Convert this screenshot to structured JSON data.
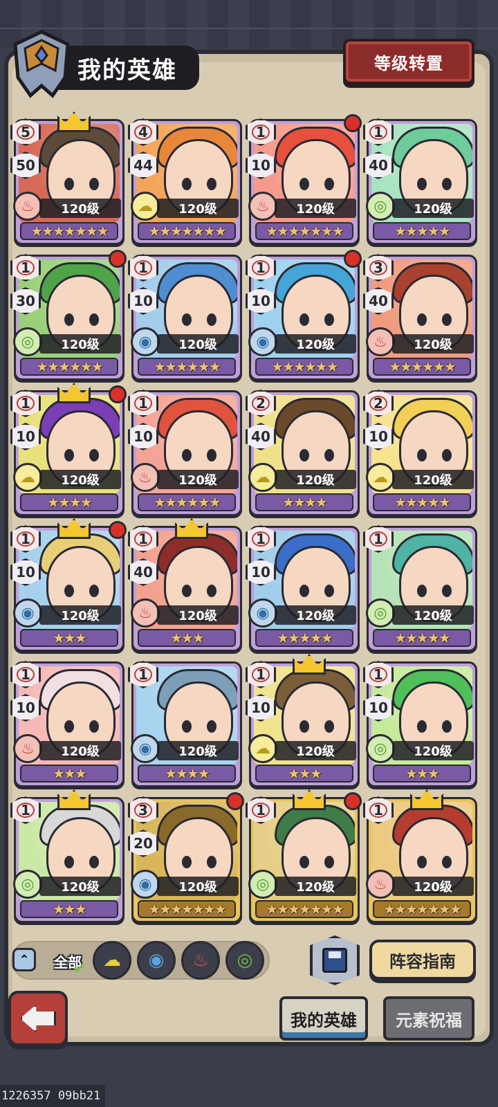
{
  "header": {
    "title": "我的英雄",
    "rank_transfer_button": "等级转置"
  },
  "colors": {
    "fire": "#c83d33",
    "water": "#2f6ea5",
    "earth": "#b89b18",
    "wind": "#4e9c2b",
    "card_purple": "#bda0d8",
    "card_gold": "#e7c45d",
    "button_red": "#8c2c2a"
  },
  "heroes": [
    {
      "rank": "5",
      "num": "50",
      "element": "fire",
      "level": "120级",
      "stars": 7,
      "crown": true,
      "dot": false,
      "art": "#d66a56",
      "hair": "#5d4a3a",
      "gold": false
    },
    {
      "rank": "4",
      "num": "44",
      "element": "earth",
      "level": "120级",
      "stars": 7,
      "crown": false,
      "dot": false,
      "art": "#f4a55a",
      "hair": "#e8873a",
      "gold": false
    },
    {
      "rank": "1",
      "num": "10",
      "element": "fire",
      "level": "120级",
      "stars": 7,
      "crown": false,
      "dot": true,
      "art": "#f59a8c",
      "hair": "#e7503d",
      "gold": false
    },
    {
      "rank": "1",
      "num": "40",
      "element": "wind",
      "level": "120级",
      "stars": 5,
      "crown": false,
      "dot": false,
      "art": "#a9e4c2",
      "hair": "#6ecb9a",
      "gold": false
    },
    {
      "rank": "1",
      "num": "30",
      "element": "wind",
      "level": "120级",
      "stars": 6,
      "crown": false,
      "dot": true,
      "art": "#9bd07a",
      "hair": "#4fa44a",
      "gold": false
    },
    {
      "rank": "1",
      "num": "10",
      "element": "water",
      "level": "120级",
      "stars": 6,
      "crown": false,
      "dot": false,
      "art": "#a3cdea",
      "hair": "#4f8fd1",
      "gold": false
    },
    {
      "rank": "1",
      "num": "10",
      "element": "water",
      "level": "120级",
      "stars": 6,
      "crown": false,
      "dot": true,
      "art": "#9fd2ee",
      "hair": "#45a4d8",
      "gold": false
    },
    {
      "rank": "3",
      "num": "40",
      "element": "fire",
      "level": "120级",
      "stars": 6,
      "crown": false,
      "dot": false,
      "art": "#f09c7e",
      "hair": "#a8412e",
      "gold": false
    },
    {
      "rank": "1",
      "num": "10",
      "element": "earth",
      "level": "120级",
      "stars": 4,
      "crown": true,
      "dot": true,
      "art": "#e9e17a",
      "hair": "#7a3fb5",
      "gold": false
    },
    {
      "rank": "1",
      "num": "10",
      "element": "fire",
      "level": "120级",
      "stars": 6,
      "crown": false,
      "dot": false,
      "art": "#f4a496",
      "hair": "#e0533f",
      "gold": false
    },
    {
      "rank": "2",
      "num": "40",
      "element": "earth",
      "level": "120级",
      "stars": 4,
      "crown": false,
      "dot": false,
      "art": "#f1e08a",
      "hair": "#6b4a2c",
      "gold": false
    },
    {
      "rank": "2",
      "num": "10",
      "element": "earth",
      "level": "120级",
      "stars": 5,
      "crown": false,
      "dot": false,
      "art": "#f7e28f",
      "hair": "#f2cf55",
      "gold": false
    },
    {
      "rank": "1",
      "num": "10",
      "element": "water",
      "level": "120级",
      "stars": 3,
      "crown": true,
      "dot": true,
      "art": "#a6d1ed",
      "hair": "#e7cf78",
      "gold": false
    },
    {
      "rank": "1",
      "num": "40",
      "element": "fire",
      "level": "120级",
      "stars": 3,
      "crown": true,
      "dot": false,
      "art": "#f2a28f",
      "hair": "#8e2d2a",
      "gold": false
    },
    {
      "rank": "1",
      "num": "10",
      "element": "water",
      "level": "120级",
      "stars": 5,
      "crown": false,
      "dot": false,
      "art": "#a0cde9",
      "hair": "#3a6ec8",
      "gold": false
    },
    {
      "rank": "1",
      "num": "",
      "element": "wind",
      "level": "120级",
      "stars": 5,
      "crown": false,
      "dot": false,
      "art": "#b6e3b5",
      "hair": "#4fb3a6",
      "gold": false
    },
    {
      "rank": "1",
      "num": "10",
      "element": "fire",
      "level": "120级",
      "stars": 3,
      "crown": false,
      "dot": false,
      "art": "#f6b9b6",
      "hair": "#f1dfe2",
      "gold": false
    },
    {
      "rank": "1",
      "num": "",
      "element": "water",
      "level": "120级",
      "stars": 4,
      "crown": false,
      "dot": false,
      "art": "#a9d4ef",
      "hair": "#7e9fb8",
      "gold": false
    },
    {
      "rank": "1",
      "num": "10",
      "element": "earth",
      "level": "120级",
      "stars": 3,
      "crown": true,
      "dot": false,
      "art": "#f0e38e",
      "hair": "#7a5e3a",
      "gold": false
    },
    {
      "rank": "1",
      "num": "10",
      "element": "wind",
      "level": "120级",
      "stars": 3,
      "crown": false,
      "dot": false,
      "art": "#c6ea9c",
      "hair": "#4fbf5a",
      "gold": false
    },
    {
      "rank": "1",
      "num": "",
      "element": "wind",
      "level": "120级",
      "stars": 3,
      "crown": true,
      "dot": false,
      "art": "#cbe9a6",
      "hair": "#d8d8d8",
      "gold": false
    },
    {
      "rank": "3",
      "num": "20",
      "element": "water",
      "level": "120级",
      "stars": 7,
      "crown": false,
      "dot": true,
      "art": "#d9b55a",
      "hair": "#8a6a2a",
      "gold": true
    },
    {
      "rank": "1",
      "num": "",
      "element": "wind",
      "level": "120级",
      "stars": 7,
      "crown": true,
      "dot": true,
      "art": "#e5cf88",
      "hair": "#3e7d48",
      "gold": true
    },
    {
      "rank": "1",
      "num": "",
      "element": "fire",
      "level": "120级",
      "stars": 7,
      "crown": true,
      "dot": false,
      "art": "#edc982",
      "hair": "#b53c2f",
      "gold": true
    }
  ],
  "filter": {
    "all_label": "全部",
    "elements": [
      "earth",
      "water",
      "fire",
      "wind"
    ]
  },
  "icons": {
    "fire": "♨",
    "water": "◉",
    "earth": "☁",
    "wind": "◎",
    "collapse": "⌃"
  },
  "buttons": {
    "lineup_guide": "阵容指南",
    "save": "save-icon"
  },
  "tabs": {
    "my_heroes": "我的英雄",
    "element_blessing": "元素祝福"
  },
  "footer": {
    "build_id": "1226357 09bb21"
  }
}
